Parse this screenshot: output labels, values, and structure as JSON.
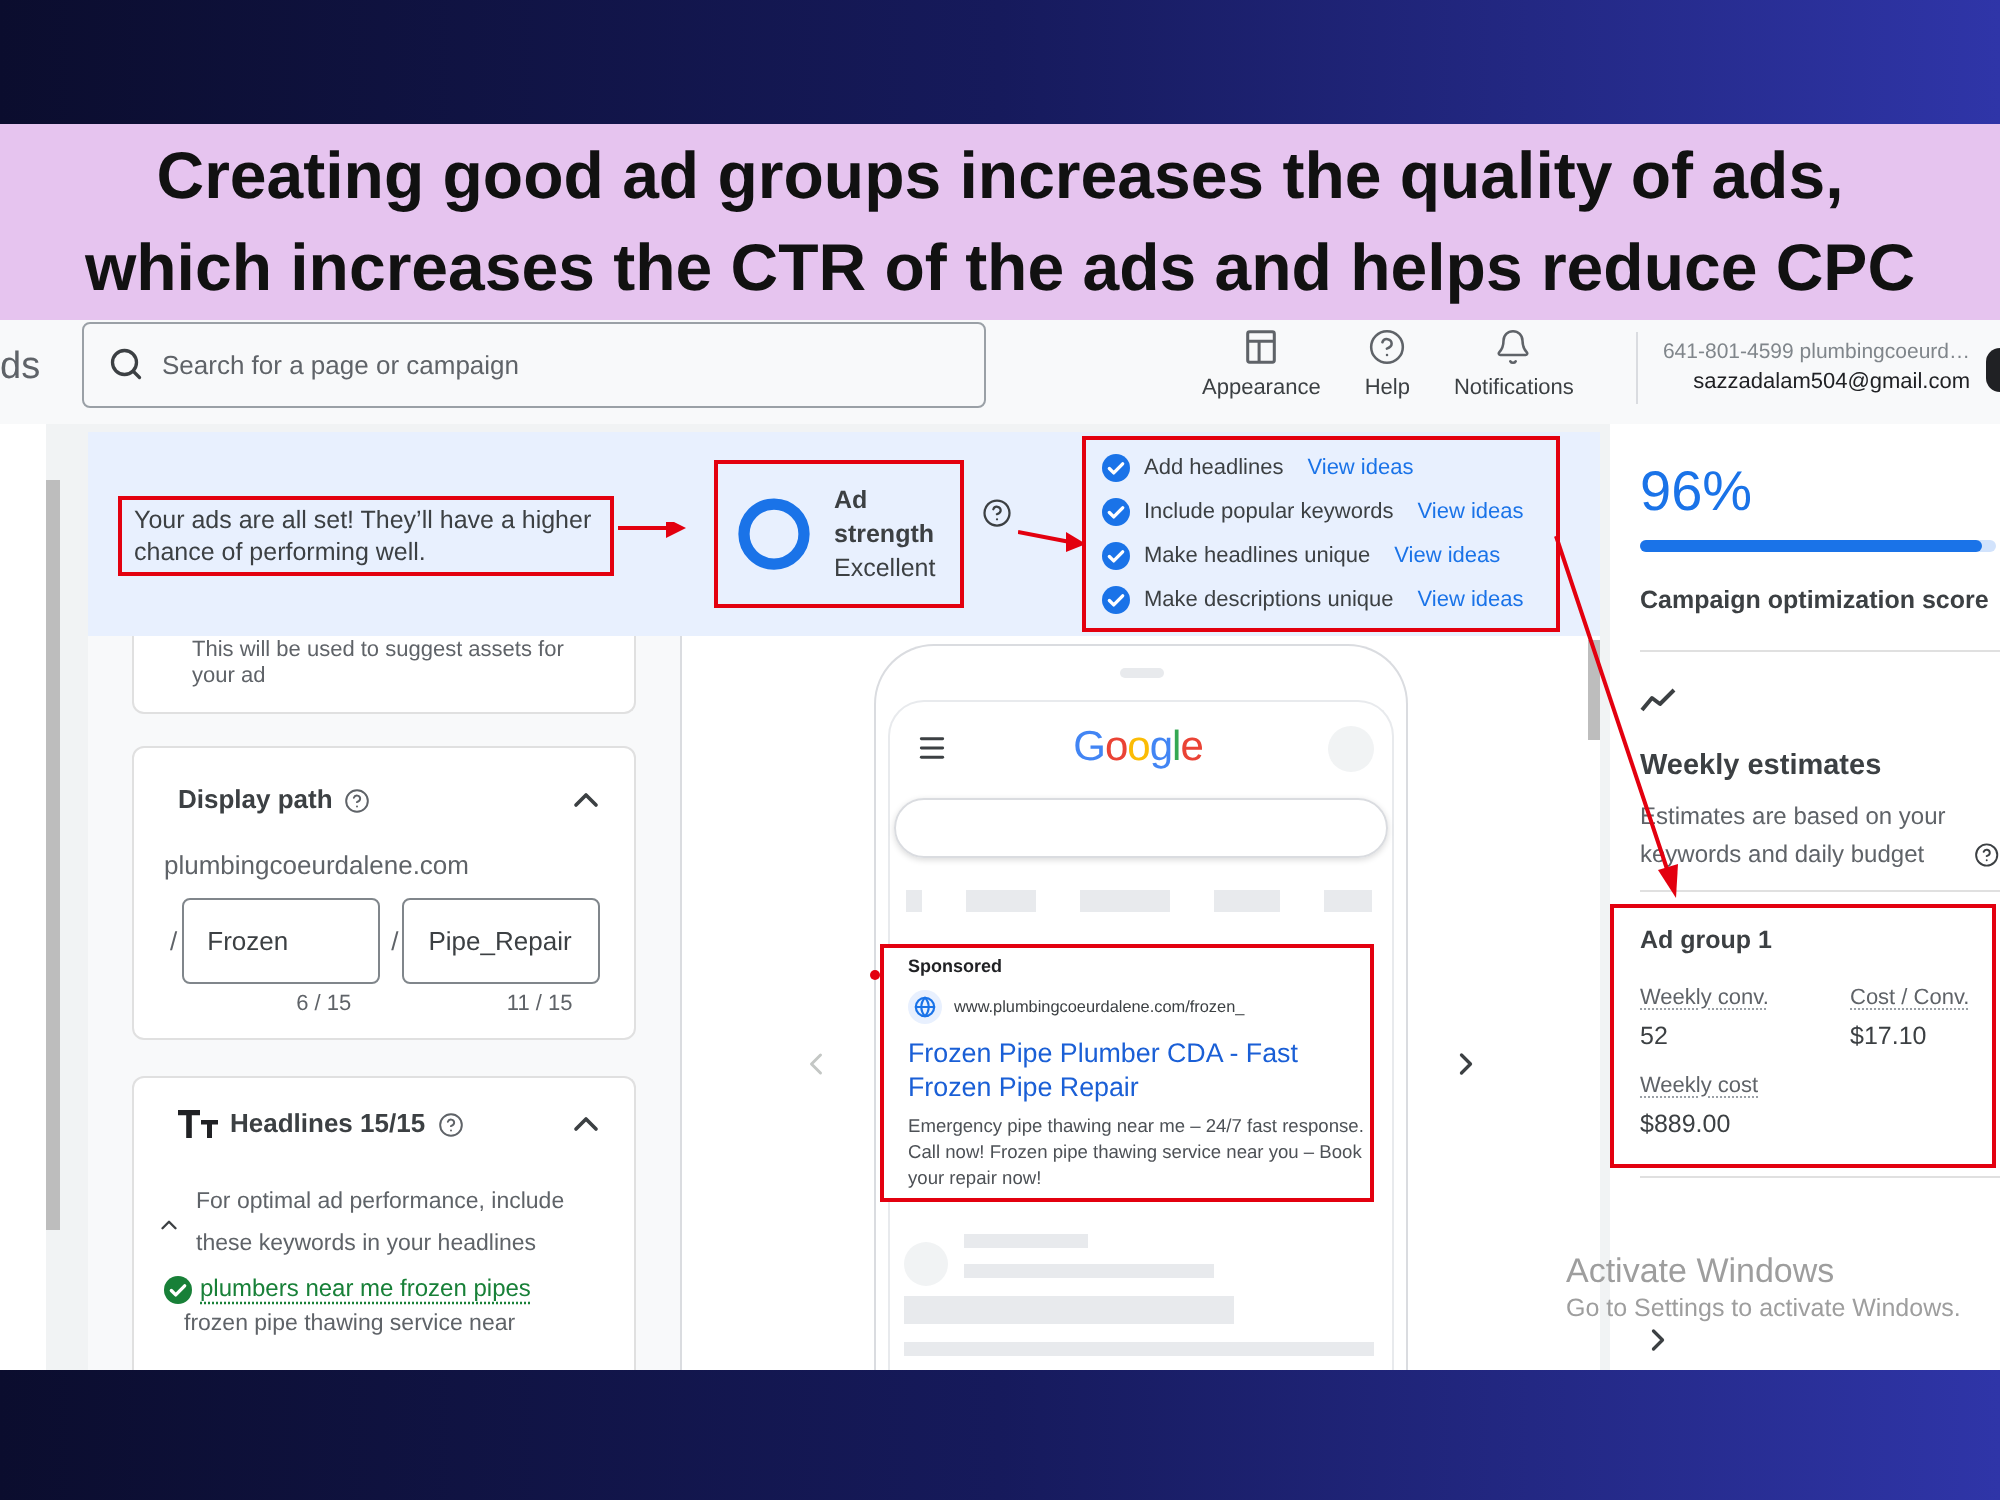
{
  "headline": {
    "lines": [
      "Creating good ad groups increases the quality of ads,",
      "which increases the CTR of the ads and helps reduce CPC"
    ]
  },
  "header": {
    "product_fragment": "ds",
    "search": {
      "placeholder": "Search for a page or campaign"
    },
    "actions": [
      {
        "kind": "appearance",
        "label": "Appearance"
      },
      {
        "kind": "help",
        "label": "Help"
      },
      {
        "kind": "notifications",
        "label": "Notifications"
      }
    ],
    "account": {
      "name": "641-801-4599 plumbingcoeurd…",
      "email": "sazzadalam504@gmail.com"
    }
  },
  "ad_strength": {
    "message": {
      "text": "Your ads are all set! They’ll have a higher chance of performing well.",
      "annotated": true
    },
    "strength": {
      "label": "Ad strength",
      "rating": "Excellent",
      "level": 1,
      "annotated": true
    },
    "checklist": {
      "annotated": true,
      "items": [
        {
          "label": "Add headlines",
          "done": true,
          "link": "View ideas"
        },
        {
          "label": "Include popular keywords",
          "done": true,
          "link": "View ideas"
        },
        {
          "label": "Make headlines unique",
          "done": true,
          "link": "View ideas"
        },
        {
          "label": "Make descriptions unique",
          "done": true,
          "link": "View ideas"
        }
      ]
    }
  },
  "asset_form": {
    "hint": "This will be used to suggest assets for your ad",
    "display_path": {
      "title": "Display path",
      "expanded": true,
      "domain": "plumbingcoeurdalene.com",
      "fields": [
        {
          "separator": "/",
          "value": "Frozen",
          "counter": "6 / 15"
        },
        {
          "separator": "/",
          "value": "Pipe_Repair",
          "counter": "11 / 15"
        }
      ]
    },
    "headlines": {
      "title": "Headlines 15/15",
      "expanded": true,
      "tip_expanded": true,
      "tip": "For optimal ad performance, include these keywords in your headlines",
      "keywords": [
        {
          "text": "plumbers near me frozen pipes",
          "included": true
        },
        {
          "text": "frozen pipe thawing service near",
          "included": false
        }
      ]
    }
  },
  "preview": {
    "logo": "Google",
    "carousel": {
      "previous_disabled": true,
      "next_disabled": false
    },
    "ad": {
      "annotated": true,
      "label": "Sponsored",
      "url": "www.plumbingcoeurdalene.com/frozen_",
      "title": "Frozen Pipe Plumber CDA - Fast Frozen Pipe Repair",
      "description": "Emergency pipe thawing near me – 24/7 fast response. Call now! Frozen pipe thawing service near you – Book your repair now!"
    }
  },
  "summary": {
    "score": "96%",
    "level": 0.96,
    "score_label": "Campaign optimization score",
    "estimates": {
      "title": "Weekly estimates",
      "note": "Estimates are based on your keywords and daily budget",
      "ad_group": {
        "annotated": true,
        "name": "Ad group 1",
        "metrics": [
          {
            "label": "Weekly conv.",
            "value": "52"
          },
          {
            "label": "Cost / Conv.",
            "value": "$17.10"
          },
          {
            "label": "Weekly cost",
            "value": "$889.00"
          }
        ]
      }
    }
  },
  "windows_notice": {
    "title": "Activate Windows",
    "subtitle": "Go to Settings to activate Windows."
  }
}
